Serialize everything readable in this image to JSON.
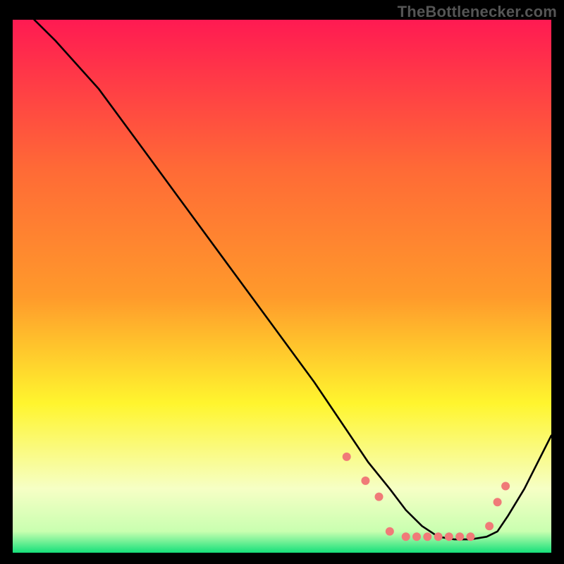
{
  "watermark": "TheBottlenecker.com",
  "chart_data": {
    "type": "line",
    "title": "",
    "xlabel": "",
    "ylabel": "",
    "xlim": [
      0,
      100
    ],
    "ylim": [
      0,
      100
    ],
    "background_gradient": {
      "top": "#ff1a52",
      "upper_mid": "#ff9a2b",
      "mid": "#fff52e",
      "lower": "#f6ffc5",
      "bottom": "#16e07a"
    },
    "outer_background": "#000000",
    "series": [
      {
        "name": "bottleneck-curve",
        "color": "#000000",
        "x": [
          4,
          8,
          16,
          24,
          32,
          40,
          48,
          56,
          62,
          66,
          70,
          73,
          76,
          79,
          82,
          85,
          88,
          90,
          92,
          95,
          100
        ],
        "y": [
          100,
          96,
          87,
          76,
          65,
          54,
          43,
          32,
          23,
          17,
          12,
          8,
          5,
          3,
          2.5,
          2.5,
          3,
          4,
          7,
          12,
          22
        ]
      }
    ],
    "markers": {
      "name": "highlight-points",
      "color": "#f07a78",
      "radius": 6,
      "x": [
        62,
        65.5,
        68,
        70,
        73,
        75,
        77,
        79,
        81,
        83,
        85,
        88.5,
        90,
        91.5
      ],
      "y": [
        18,
        13.5,
        10.5,
        4,
        3,
        3,
        3,
        3,
        3,
        3,
        3,
        5,
        9.5,
        12.5
      ]
    }
  }
}
